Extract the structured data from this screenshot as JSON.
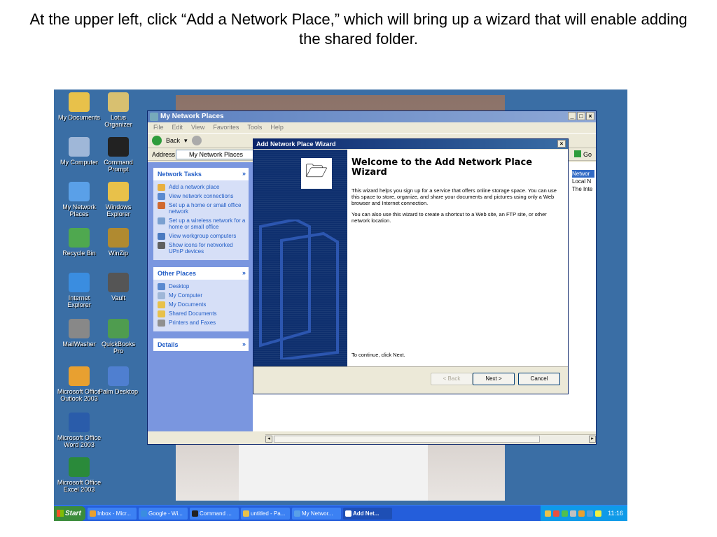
{
  "caption": "At the upper left, click “Add a Network Place,” which will bring up a wizard that will enable adding the shared folder.",
  "desktop": {
    "icons": [
      {
        "label": "My Documents",
        "color": "#e8c14a"
      },
      {
        "label": "Lotus Organizer",
        "color": "#d8c070"
      },
      {
        "label": "My Computer",
        "color": "#9fb7d8"
      },
      {
        "label": "Command Prompt",
        "color": "#222222"
      },
      {
        "label": "My Network Places",
        "color": "#5aa0e8"
      },
      {
        "label": "Windows Explorer",
        "color": "#e8c14a"
      },
      {
        "label": "Recycle Bin",
        "color": "#4fa84f"
      },
      {
        "label": "WinZip",
        "color": "#b08a30"
      },
      {
        "label": "Internet Explorer",
        "color": "#3a8de0"
      },
      {
        "label": "Vault",
        "color": "#555555"
      },
      {
        "label": "MailWasher",
        "color": "#888888"
      },
      {
        "label": "QuickBooks Pro",
        "color": "#4f9c4f"
      },
      {
        "label": "Microsoft Office Outlook 2003",
        "color": "#e8a030"
      },
      {
        "label": "Palm Desktop",
        "color": "#4f7fd0"
      },
      {
        "label": "Microsoft Office Word 2003",
        "color": "#2a5caa"
      },
      {
        "label": "Microsoft Office Excel 2003",
        "color": "#2a8a3a"
      }
    ]
  },
  "explorer": {
    "title": "My Network Places",
    "menu": [
      "File",
      "Edit",
      "View",
      "Favorites",
      "Tools",
      "Help"
    ],
    "back_label": "Back",
    "address_label": "Address",
    "address_value": "My Network Places",
    "go_label": "Go",
    "network_tasks": {
      "title": "Network Tasks",
      "items": [
        "Add a network place",
        "View network connections",
        "Set up a home or small office network",
        "Set up a wireless network for a home or small office",
        "View workgroup computers",
        "Show icons for networked UPnP devices"
      ]
    },
    "other_places": {
      "title": "Other Places",
      "items": [
        "Desktop",
        "My Computer",
        "My Documents",
        "Shared Documents",
        "Printers and Faxes"
      ]
    },
    "details_title": "Details",
    "right_list": [
      "Networ",
      "Local N",
      "The Inte"
    ]
  },
  "wizard": {
    "title": "Add Network Place Wizard",
    "heading": "Welcome to the Add Network Place Wizard",
    "para1": "This wizard helps you sign up for a service that offers online storage space. You can use this space to store, organize, and share your documents and pictures using only a Web browser and Internet connection.",
    "para2": "You can also use this wizard to create a shortcut to a Web site, an FTP site, or other network location.",
    "continue_text": "To continue, click Next.",
    "back_button": "< Back",
    "next_button": "Next >",
    "cancel_button": "Cancel"
  },
  "taskbar": {
    "start_label": "Start",
    "buttons": [
      {
        "label": "Inbox - Micr...",
        "color": "#e8a030"
      },
      {
        "label": "Google - Wi...",
        "color": "#3a8de0"
      },
      {
        "label": "Command ...",
        "color": "#222222"
      },
      {
        "label": "untitled - Pa...",
        "color": "#e8c14a"
      },
      {
        "label": "My Networ...",
        "color": "#5aa0e8"
      },
      {
        "label": "Add Net...",
        "color": "#ffffff"
      }
    ],
    "clock": "11:16"
  }
}
